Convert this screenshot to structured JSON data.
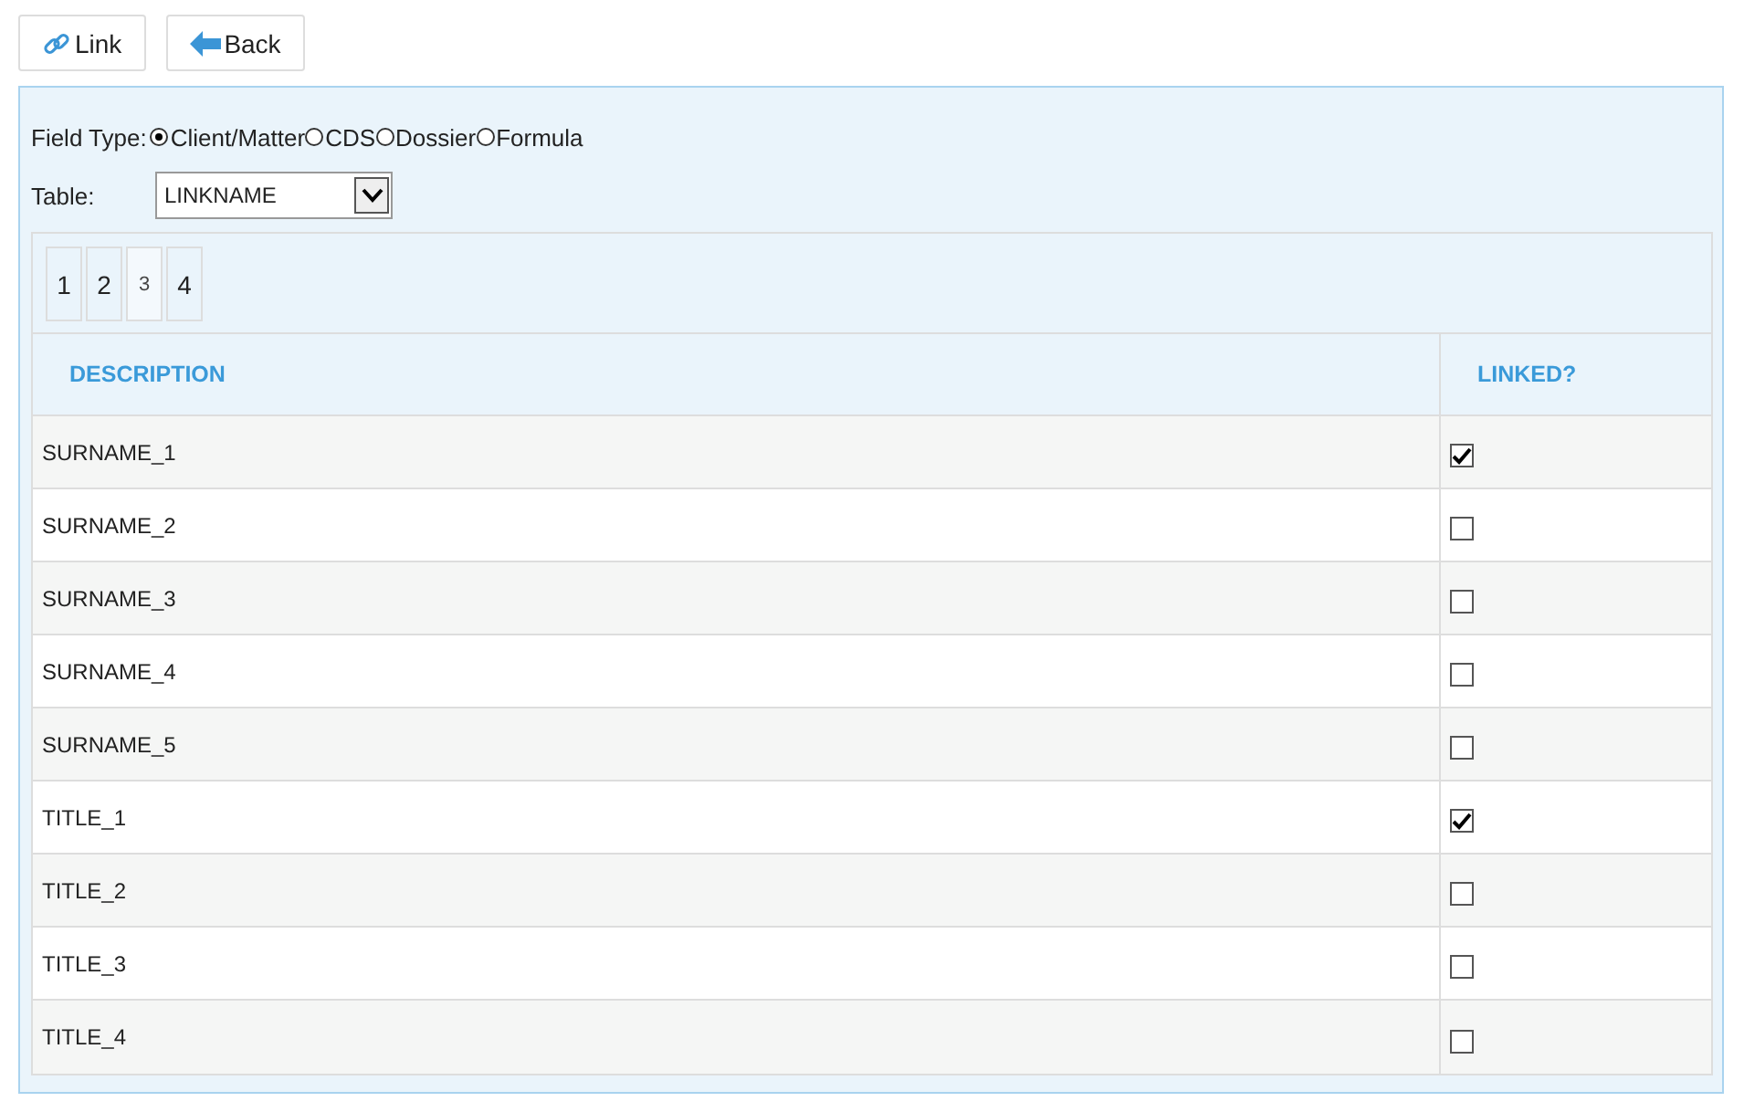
{
  "toolbar": [
    {
      "kind": "link",
      "label": "Link"
    },
    {
      "kind": "back",
      "label": "Back"
    }
  ],
  "field_type": {
    "label": "Field Type:",
    "options": [
      {
        "label": "Client/Matter",
        "selected": true
      },
      {
        "label": "CDS",
        "selected": false
      },
      {
        "label": "Dossier",
        "selected": false
      },
      {
        "label": "Formula",
        "selected": false
      }
    ]
  },
  "table_select": {
    "label": "Table:",
    "value": "LINKNAME"
  },
  "pages": [
    {
      "label": "1",
      "selected": false
    },
    {
      "label": "2",
      "selected": false
    },
    {
      "label": "3",
      "selected": true
    },
    {
      "label": "4",
      "selected": false
    }
  ],
  "table": {
    "columns": [
      "DESCRIPTION",
      "LINKED?"
    ],
    "rows": [
      {
        "description": "SURNAME_1",
        "checked": true
      },
      {
        "description": "SURNAME_2",
        "checked": false
      },
      {
        "description": "SURNAME_3",
        "checked": false
      },
      {
        "description": "SURNAME_4",
        "checked": false
      },
      {
        "description": "SURNAME_5",
        "checked": false
      },
      {
        "description": "TITLE_1",
        "checked": true
      },
      {
        "description": "TITLE_2",
        "checked": false
      },
      {
        "description": "TITLE_3",
        "checked": false
      },
      {
        "description": "TITLE_4",
        "checked": false
      }
    ]
  }
}
